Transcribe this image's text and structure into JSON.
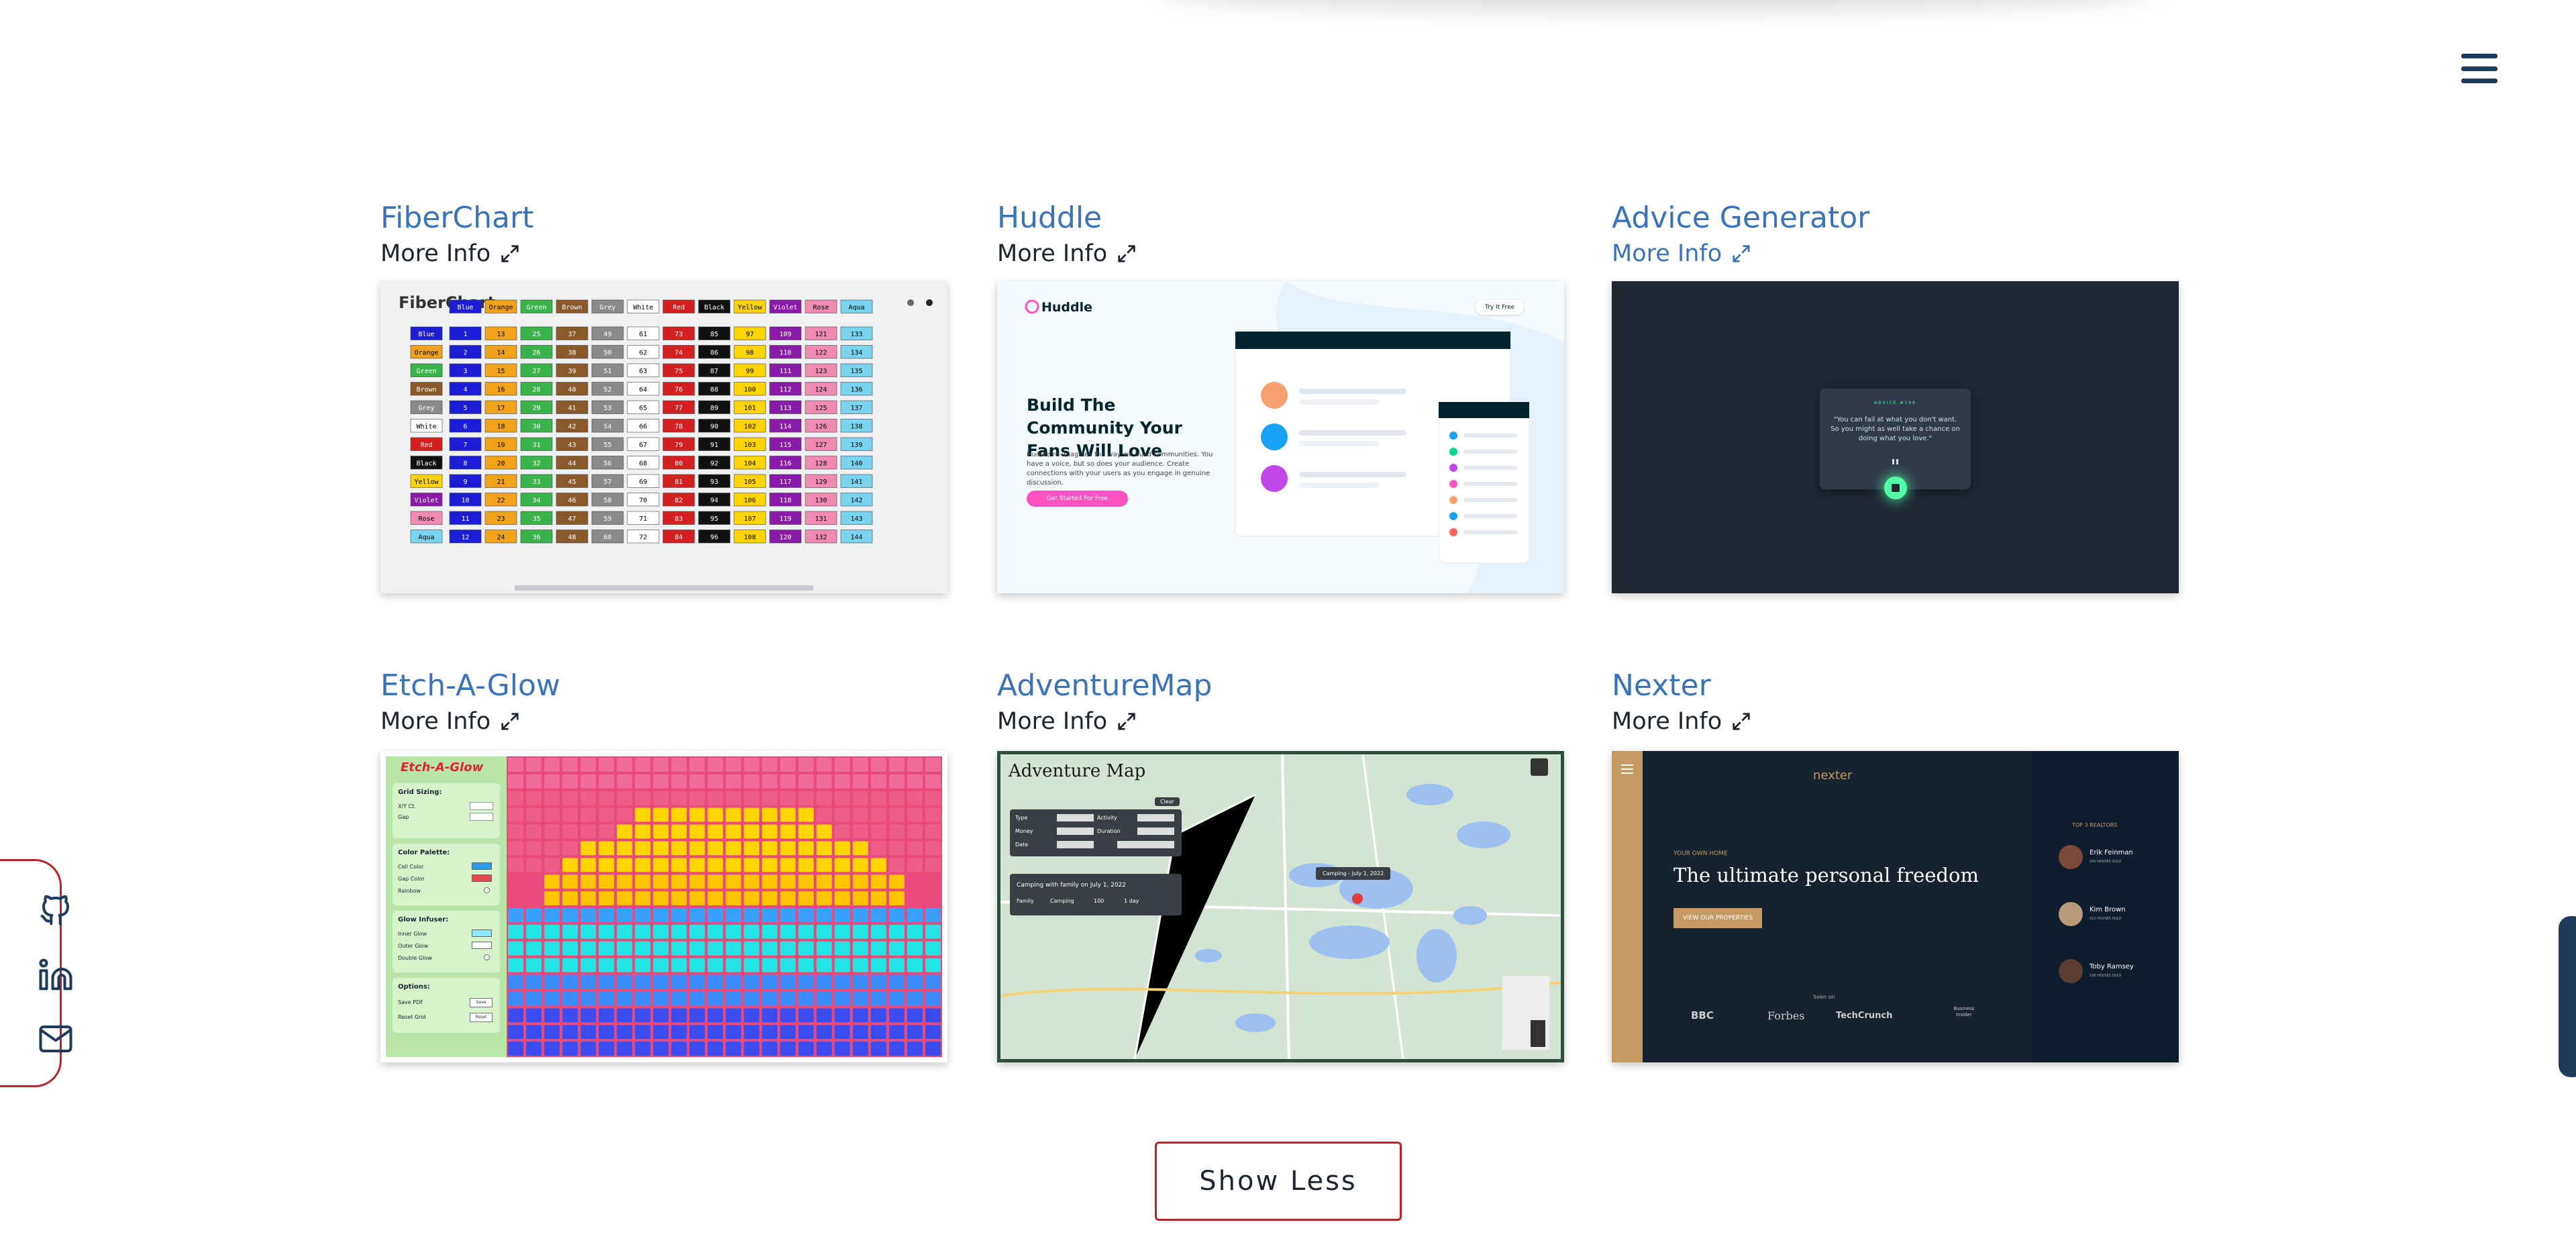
{
  "nav": {
    "menu_icon": "hamburger-icon"
  },
  "projects": [
    {
      "title": "FiberChart",
      "more_info": "More Info",
      "thumbnail": {
        "app_title": "FiberChart",
        "colors": [
          "Blue",
          "Orange",
          "Green",
          "Brown",
          "Grey",
          "White",
          "Red",
          "Black",
          "Yellow",
          "Violet",
          "Rose",
          "Aqua"
        ]
      }
    },
    {
      "title": "Huddle",
      "more_info": "More Info",
      "thumbnail": {
        "logo": "Huddle",
        "cta_top": "Try It Free",
        "headline": "Build The Community Your Fans Will Love",
        "body": "Huddle re-imagines the way we build communities. You have a voice, but so does your audience. Create connections with your users as you engage in genuine discussion.",
        "cta": "Get Started For Free"
      }
    },
    {
      "title": "Advice Generator",
      "more_info": "More Info",
      "thumbnail": {
        "label": "ADVICE #196",
        "quote": "\"You can fail at what you don't want. So you might as well take a chance on doing what you love.\""
      }
    },
    {
      "title": "Etch-A-Glow",
      "more_info": "More Info",
      "thumbnail": {
        "app_title": "Etch-A-Glow",
        "sections": [
          "Grid Sizing:",
          "Color Palette:",
          "Glow Infuser:",
          "Options:"
        ],
        "grid_labels": [
          "X/Y Ct.",
          "Gap"
        ],
        "palette_labels": [
          "Cell Color",
          "Gap Color",
          "Rainbow"
        ],
        "glow_labels": [
          "Inner Glow",
          "Outer Glow",
          "Double Glow"
        ],
        "option_labels": [
          "Save PDF",
          "Reset Grid"
        ],
        "option_buttons": [
          "Save",
          "Reset"
        ]
      }
    },
    {
      "title": "AdventureMap",
      "more_info": "More Info",
      "thumbnail": {
        "app_title": "Adventure Map",
        "filter_labels": [
          "Type",
          "Activity",
          "Money",
          "Duration",
          "Date"
        ],
        "clear": "Clear",
        "entry": "Camping with family on July 1, 2022",
        "entry_tags": [
          "Family",
          "Camping",
          "100",
          "1 day"
        ],
        "popup": "Camping - July 1, 2022"
      }
    },
    {
      "title": "Nexter",
      "more_info": "More Info",
      "thumbnail": {
        "logo": "nexter",
        "eyebrow": "YOUR OWN HOME",
        "headline": "The ultimate personal freedom",
        "cta": "VIEW OUR PROPERTIES",
        "seen_on": "Seen on",
        "press": [
          "BBC",
          "Forbes",
          "TechCrunch",
          "Business Insider"
        ],
        "realtors_title": "TOP 3 REALTORS",
        "realtors": [
          {
            "name": "Erik Feinman",
            "sales": "245 HOUSES SOLD"
          },
          {
            "name": "Kim Brown",
            "sales": "212 HOUSES SOLD"
          },
          {
            "name": "Toby Ramsey",
            "sales": "198 HOUSES SOLD"
          }
        ]
      }
    }
  ],
  "show_less": "Show Less",
  "social": [
    "github-icon",
    "linkedin-icon",
    "mail-icon"
  ],
  "colors": {
    "title_blue": "#3b73b9",
    "accent_red": "#b8232a",
    "navy": "#1f3b5c"
  }
}
